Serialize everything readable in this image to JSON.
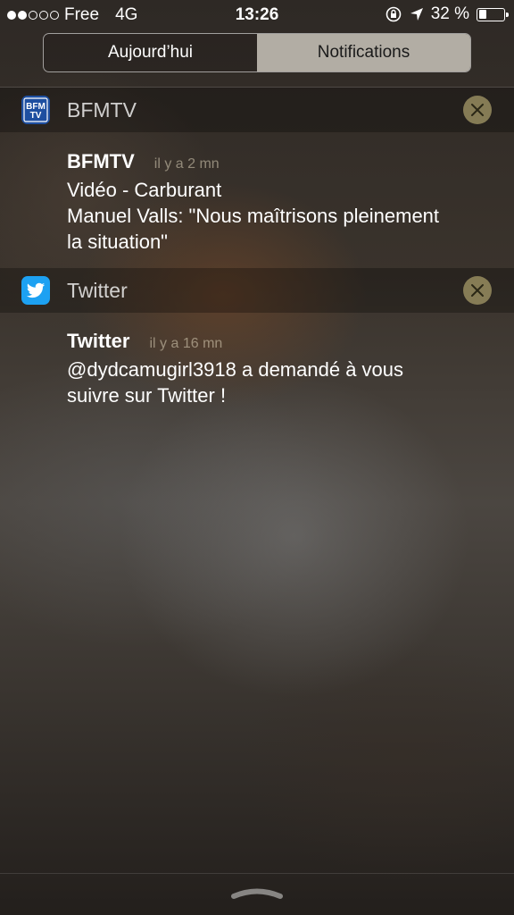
{
  "status_bar": {
    "carrier": "Free",
    "network": "4G",
    "time": "13:26",
    "battery_text": "32 %",
    "battery_level": 0.32,
    "signal_bars_filled": 2,
    "signal_bars_total": 5
  },
  "tabs": [
    {
      "label": "Aujourd’hui",
      "selected": false
    },
    {
      "label": "Notifications",
      "selected": true
    }
  ],
  "groups": [
    {
      "app_name": "BFMTV",
      "icon": "bfmtv-app-icon",
      "icon_text": "BFM TV",
      "icon_color": "#1e4fa0",
      "notifications": [
        {
          "title": "BFMTV",
          "time": "il y a 2 mn",
          "lines": [
            "Vidéo - Carburant",
            "Manuel Valls: \"Nous maîtrisons pleinement",
            "la situation\""
          ]
        }
      ]
    },
    {
      "app_name": "Twitter",
      "icon": "twitter-bird-icon",
      "icon_color": "#1da1f2",
      "notifications": [
        {
          "title": "Twitter",
          "time": "il y a 16 mn",
          "lines": [
            "@dydcamugirl3918 a demandé à vous",
            "suivre sur Twitter !"
          ]
        }
      ]
    }
  ],
  "colors": {
    "clear_button": "#968c5f",
    "selected_tab": "#d7d2c8"
  }
}
